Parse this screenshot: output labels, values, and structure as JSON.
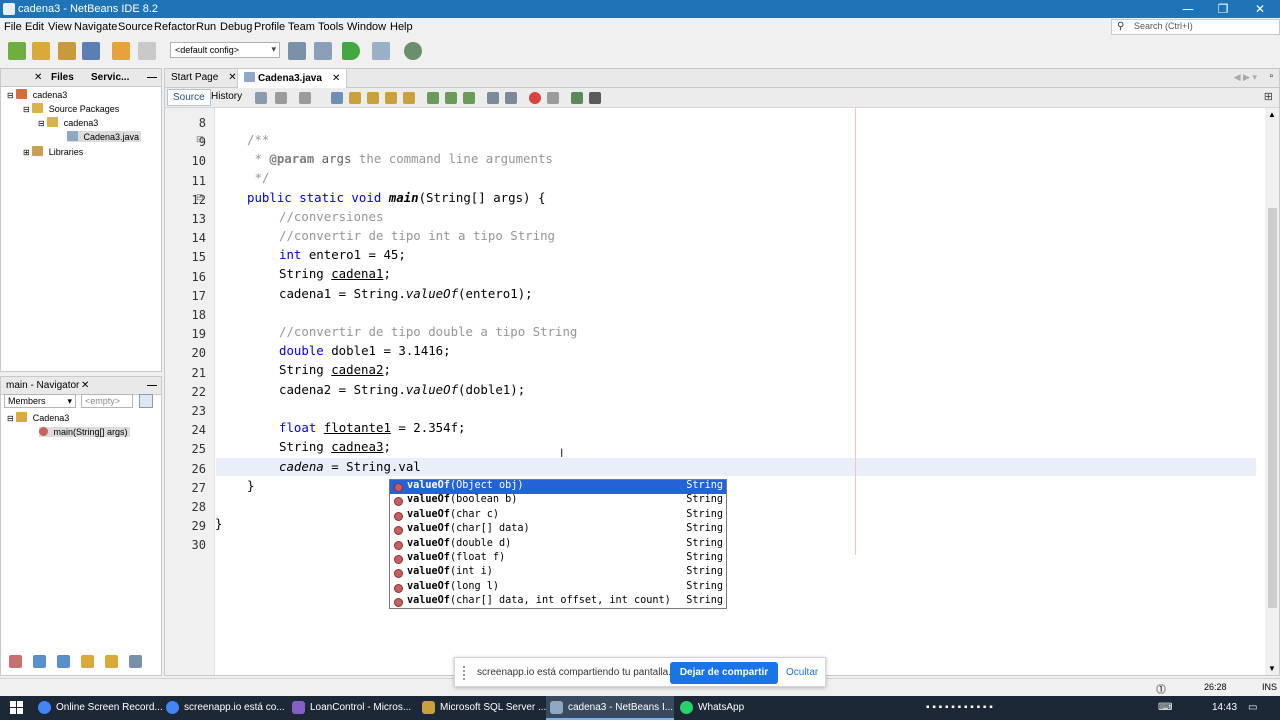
{
  "window": {
    "title": "cadena3 - NetBeans IDE 8.2",
    "minimize": "—",
    "maximize": "❐",
    "close": "✕"
  },
  "menu": [
    "File",
    "Edit",
    "View",
    "Navigate",
    "Source",
    "Refactor",
    "Run",
    "Debug",
    "Profile",
    "Team",
    "Tools",
    "Window",
    "Help"
  ],
  "search": {
    "placeholder": "Search (Ctrl+I)"
  },
  "toolbar": {
    "config": "<default config>"
  },
  "projects": {
    "tabs": [
      "Files",
      "Servic..."
    ],
    "tree": [
      "cadena3",
      "Source Packages",
      "cadena3",
      "Cadena3.java",
      "Libraries"
    ]
  },
  "navigator": {
    "title": "main - Navigator",
    "members": "Members",
    "empty": "<empty>",
    "tree": [
      "Cadena3",
      "main(String[] args)"
    ]
  },
  "editor": {
    "tabs": [
      "Start Page",
      "Cadena3.java"
    ],
    "subtabs": [
      "Source",
      "History"
    ],
    "line_numbers": [
      "8",
      "9",
      "10",
      "11",
      "12",
      "13",
      "14",
      "15",
      "16",
      "17",
      "18",
      "19",
      "20",
      "21",
      "22",
      "23",
      "24",
      "25",
      "26",
      "27",
      "28",
      "29",
      "30"
    ],
    "autocomplete": [
      {
        "name": "valueOf",
        "params": "(Object obj)",
        "ret": "String"
      },
      {
        "name": "valueOf",
        "params": "(boolean b)",
        "ret": "String"
      },
      {
        "name": "valueOf",
        "params": "(char c)",
        "ret": "String"
      },
      {
        "name": "valueOf",
        "params": "(char[] data)",
        "ret": "String"
      },
      {
        "name": "valueOf",
        "params": "(double d)",
        "ret": "String"
      },
      {
        "name": "valueOf",
        "params": "(float f)",
        "ret": "String"
      },
      {
        "name": "valueOf",
        "params": "(int i)",
        "ret": "String"
      },
      {
        "name": "valueOf",
        "params": "(long l)",
        "ret": "String"
      },
      {
        "name": "valueOf",
        "params": "(char[] data, int offset, int count)",
        "ret": "String"
      }
    ]
  },
  "share": {
    "message": "screenapp.io está compartiendo tu pantalla.",
    "stop": "Dejar de compartir",
    "hide": "Ocultar"
  },
  "status": {
    "position": "26:28",
    "mode": "INS"
  },
  "taskbar": {
    "items": [
      "Online Screen Record...",
      "screenapp.io está co...",
      "LoanControl - Micros...",
      "Microsoft SQL Server ...",
      "cadena3 - NetBeans I...",
      "WhatsApp"
    ],
    "time": "14:43"
  }
}
